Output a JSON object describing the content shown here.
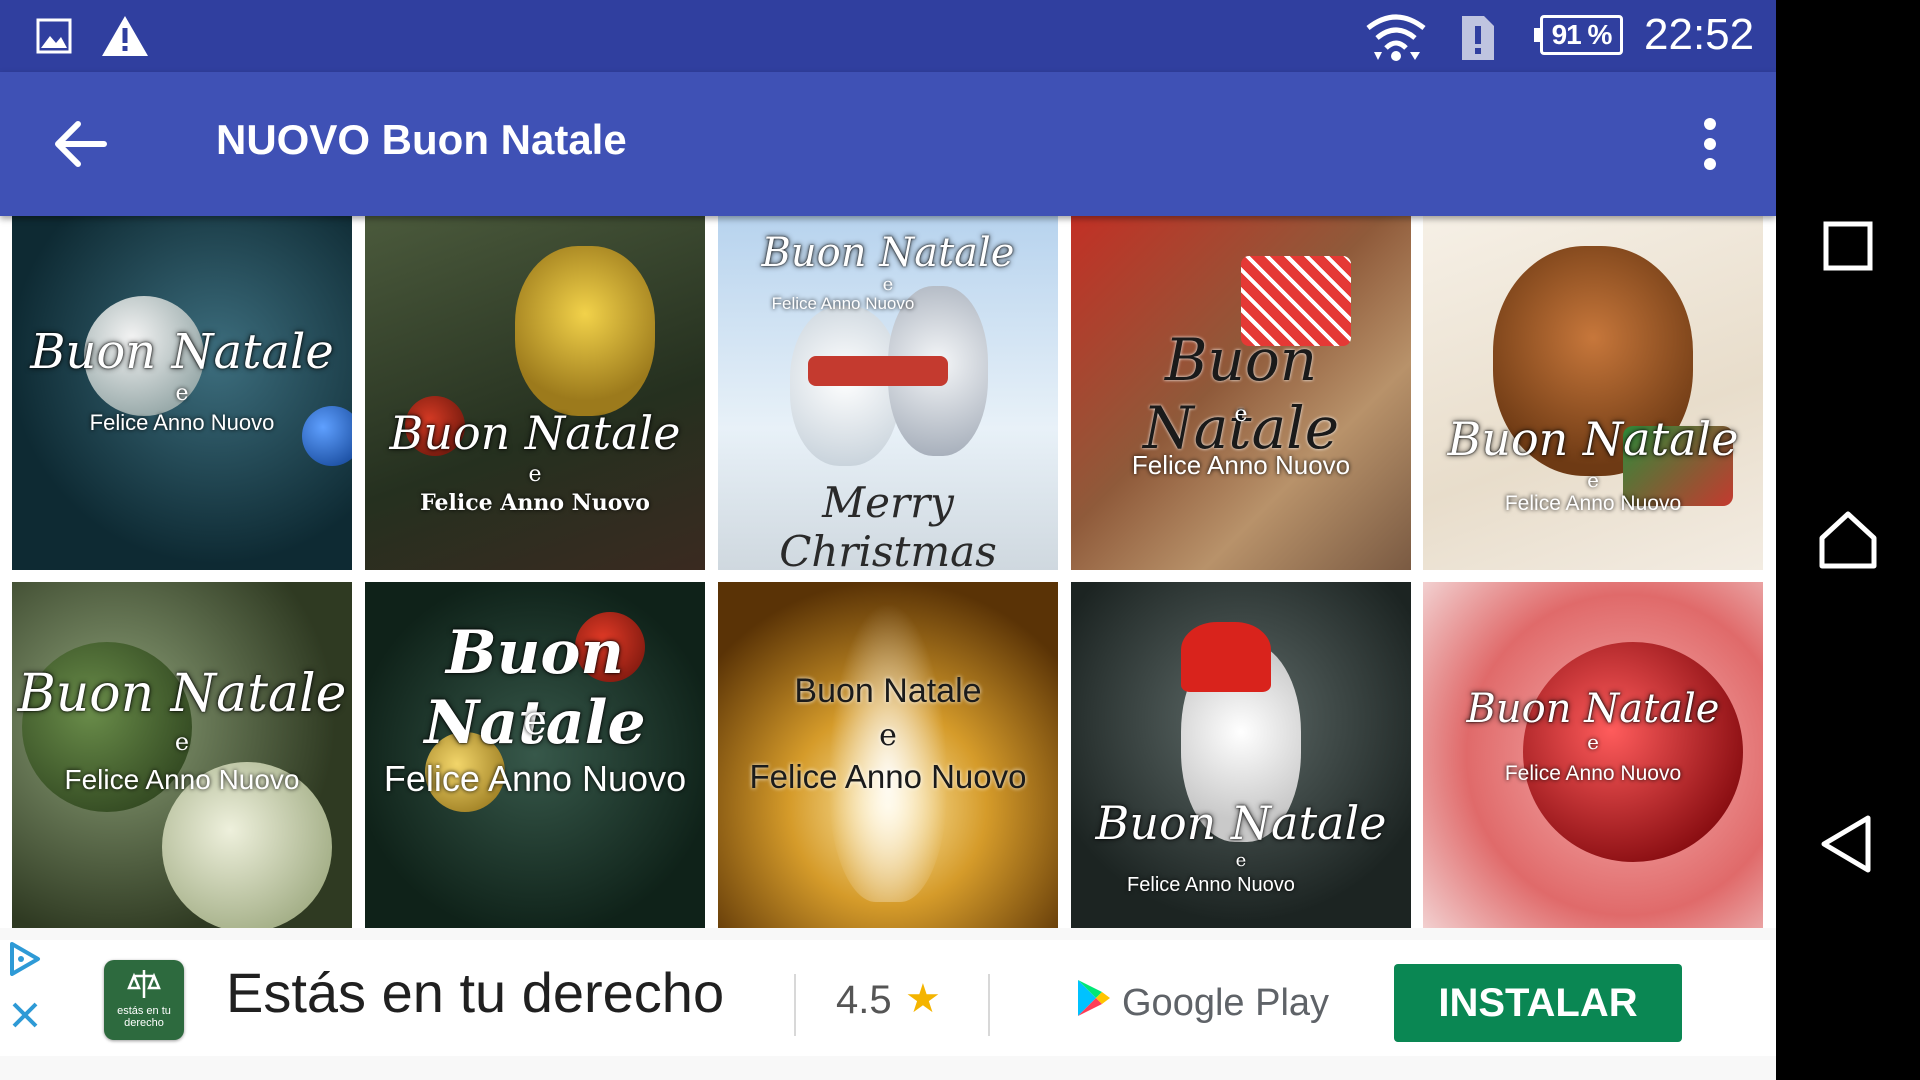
{
  "status_bar": {
    "icons": [
      "image-icon",
      "warning-icon",
      "wifi-icon",
      "sim-alert-icon"
    ],
    "battery": "91 %",
    "time": "22:52"
  },
  "app_bar": {
    "title": "NUOVO Buon Natale",
    "back_icon": "arrow-back-icon",
    "menu_icon": "more-vert-icon"
  },
  "gallery": [
    {
      "main": "Buon Natale",
      "e": "e",
      "sub": "Felice Anno Nuovo"
    },
    {
      "main": "Buon Natale",
      "e": "e",
      "sub": "Felice Anno Nuovo"
    },
    {
      "main": "Buon Natale",
      "e": "e",
      "sub": "Felice Anno Nuovo",
      "extra": "Merry Christmas"
    },
    {
      "main": "Buon Natale",
      "e": "e",
      "sub": "Felice Anno Nuovo"
    },
    {
      "main": "Buon Natale",
      "e": "e",
      "sub": "Felice Anno Nuovo"
    },
    {
      "main": "Buon Natale",
      "e": "e",
      "sub": "Felice Anno Nuovo"
    },
    {
      "main": "Buon Natale",
      "e": "e",
      "sub": "Felice Anno Nuovo"
    },
    {
      "main": "Buon Natale",
      "e": "e",
      "sub": "Felice Anno Nuovo"
    },
    {
      "main": "Buon Natale",
      "e": "e",
      "sub": "Felice Anno Nuovo"
    },
    {
      "main": "Buon Natale",
      "e": "e",
      "sub": "Felice Anno Nuovo"
    }
  ],
  "ad": {
    "app_icon_text": "estás en tu derecho",
    "title": "Estás en tu derecho",
    "rating": "4.5",
    "store": "Google Play",
    "install_label": "INSTALAR"
  },
  "nav_bar": {
    "buttons": [
      "recents-square-icon",
      "home-icon",
      "back-triangle-icon"
    ]
  },
  "colors": {
    "status_bar": "#303F9F",
    "app_bar": "#3F51B5",
    "install_button": "#0a8753"
  }
}
